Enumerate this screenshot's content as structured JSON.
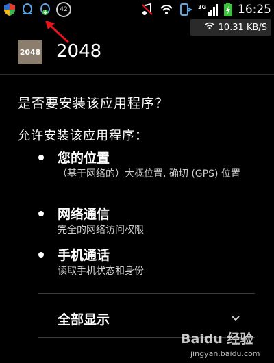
{
  "status_bar": {
    "left_icons": [
      "shield-icon",
      "qq-penguin-icon",
      "download-penguin-icon",
      "notification-count-icon"
    ],
    "notification_count": "42",
    "right_icons": [
      "music-muted-icon",
      "wifi-icon",
      "phone-signal-icon",
      "3g-signal-icon",
      "battery-charging-icon"
    ],
    "signal_label": "3G",
    "time": "16:25",
    "network_speed": "10.31 KB/S"
  },
  "app": {
    "icon_text": "2048",
    "name": "2048",
    "icon_color": "#8b7e6e"
  },
  "install": {
    "question": "是否要安装该应用程序？",
    "allow_heading": "允许安装该应用程序：",
    "permissions": [
      {
        "title": "您的位置",
        "description": "（基于网络的）大概位置, 确切 (GPS) 位置"
      },
      {
        "title": "网络通信",
        "description": "完全的网络访问权限"
      },
      {
        "title": "手机通话",
        "description": "读取手机状态和身份"
      }
    ],
    "show_all_label": "全部显示"
  },
  "watermark": {
    "main": "Baidu 经验",
    "sub": "jingyan.baidu.com"
  },
  "colors": {
    "annotation": "#e8141b",
    "battery": "#3ec13e"
  }
}
